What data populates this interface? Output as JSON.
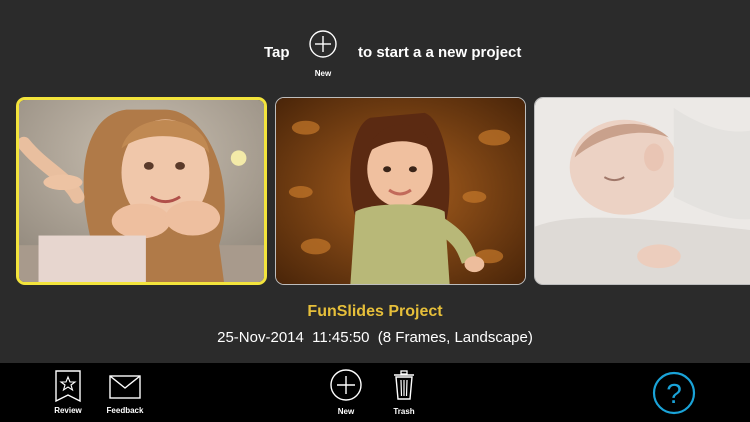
{
  "header": {
    "tap_text": "Tap",
    "new_label": "New",
    "suffix_text": "to start a a new project"
  },
  "thumbnails": [
    {
      "icon": "girl-lying-photo",
      "selected": true
    },
    {
      "icon": "girl-in-leaves-photo",
      "selected": false
    },
    {
      "icon": "sleeping-baby-photo",
      "selected": false
    }
  ],
  "project": {
    "title": "FunSlides Project",
    "info": "25-Nov-2014  11:45:50  (8 Frames, Landscape)"
  },
  "toolbar": {
    "review_label": "Review",
    "feedback_label": "Feedback",
    "new_label": "New",
    "trash_label": "Trash"
  },
  "colors": {
    "background": "#2b2b2b",
    "toolbar": "#000000",
    "selected_border": "#f3e43c",
    "project_title": "#e6bf3a",
    "help_icon": "#1aa3d8"
  }
}
